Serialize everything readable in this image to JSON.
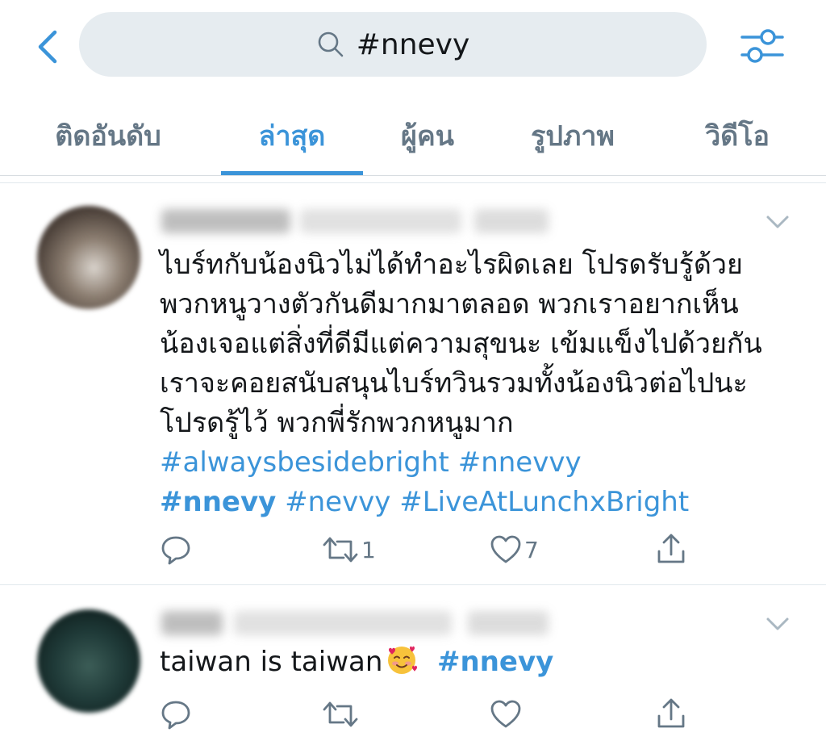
{
  "search": {
    "query": "#nnevy",
    "icon": "search-icon"
  },
  "nav": {
    "back_icon": "chevron-left-icon",
    "filter_icon": "filter-sliders-icon"
  },
  "tabs": [
    {
      "label": "ติดอันดับ",
      "active": false
    },
    {
      "label": "ล่าสุด",
      "active": true
    },
    {
      "label": "ผู้คน",
      "active": false
    },
    {
      "label": "รูปภาพ",
      "active": false
    },
    {
      "label": "วิดีโอ",
      "active": false
    }
  ],
  "colors": {
    "accent": "#3b94d9",
    "text": "#14171a",
    "muted": "#657786",
    "search_bg": "#e6ecf0"
  },
  "tweets": [
    {
      "text_lines": [
        "ไบร์ทกับน้องนิวไม่ได้ทำอะไรผิดเลย โปรดรับรู้ด้วย",
        "พวกหนูวางตัวกันดีมากมาตลอด พวกเราอยากเห็น",
        "น้องเจอแต่สิ่งที่ดีมีแต่ความสุขนะ เข้มแข็งไปด้วยกัน",
        "เราจะคอยสนับสนุนไบร์ทวินรวมทั้งน้องนิวต่อไปนะ",
        "โปรดรู้ไว้ พวกพี่รักพวกหนูมาก"
      ],
      "hashtags_line1": [
        "#alwaysbesidebright",
        "#nnevvy"
      ],
      "hashtags_line2": [
        "#nnevy",
        "#nevvy",
        "#LiveAtLunchxBright"
      ],
      "retweets": "1",
      "likes": "7"
    },
    {
      "text": "taiwan is taiwan",
      "emoji": "smiling-face-with-hearts-emoji",
      "hashtag": "#nnevy"
    }
  ]
}
